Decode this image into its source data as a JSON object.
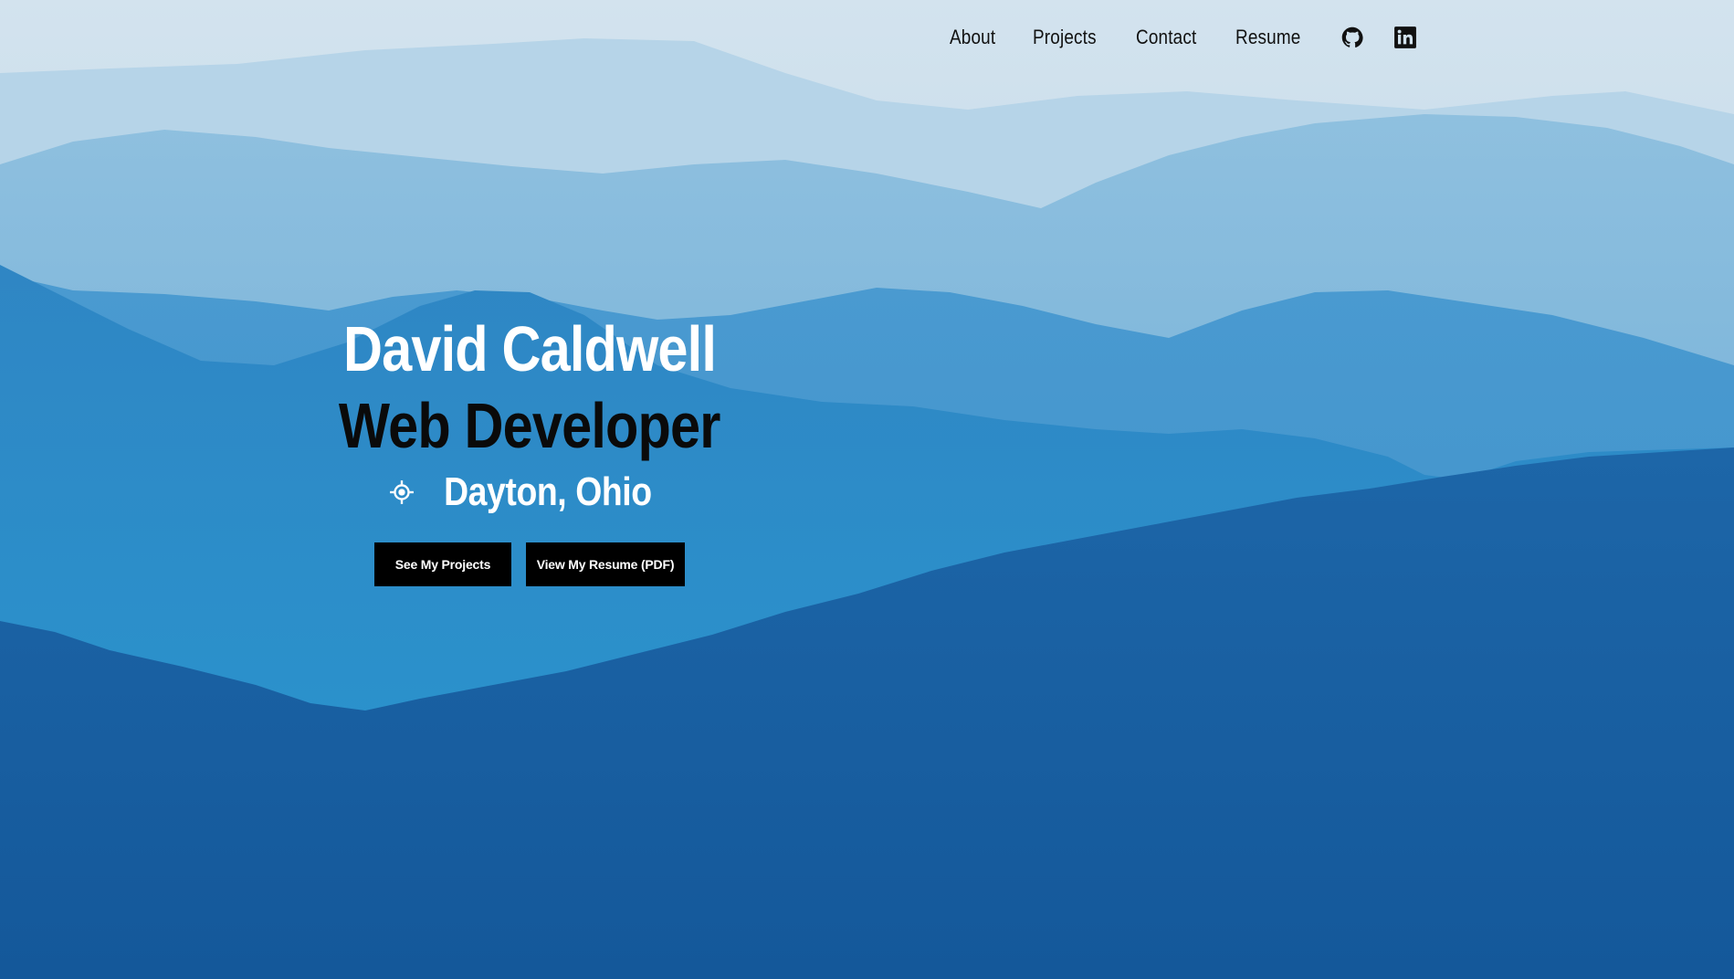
{
  "nav": {
    "links": [
      {
        "label": "About"
      },
      {
        "label": "Projects"
      },
      {
        "label": "Contact"
      },
      {
        "label": "Resume"
      }
    ],
    "icons": [
      "github-icon",
      "linkedin-icon"
    ]
  },
  "hero": {
    "name": "David Caldwell",
    "role": "Web Developer",
    "location_icon": "location-crosshair-icon",
    "location": "Dayton, Ohio",
    "buttons": {
      "projects_label": "See My Projects",
      "resume_label": "View My Resume (PDF)"
    }
  },
  "colors": {
    "sky": "#cfe0ec",
    "deep_blue": "#135a99",
    "button_bg": "#000000",
    "name_text": "#ffffff",
    "role_text": "#0a0a0a"
  }
}
